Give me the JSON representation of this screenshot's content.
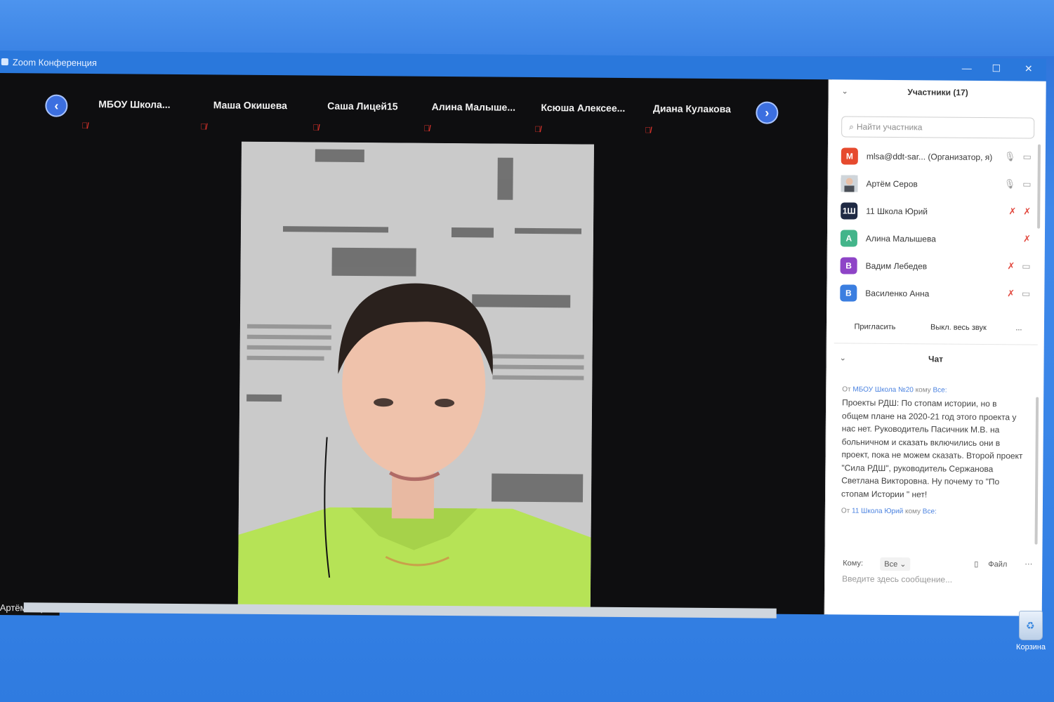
{
  "window": {
    "title": "Zoom Конференция",
    "minimize": "—",
    "maximize": "☐",
    "close": "✕"
  },
  "gallery": {
    "prev": "‹",
    "next": "›",
    "tiles": [
      {
        "name": "МБОУ  Школа...",
        "muted": "🎙̸"
      },
      {
        "name": "Маша Окишева",
        "muted": "🎙̸"
      },
      {
        "name": "Саша Лицей15",
        "muted": "🎙̸"
      },
      {
        "name": "Алина  Малыше...",
        "muted": "🎙̸"
      },
      {
        "name": "Ксюша  Алексее...",
        "muted": "🎙̸"
      },
      {
        "name": "Диана Кулакова",
        "muted": "🎙̸"
      }
    ]
  },
  "speaker": {
    "name": "Артём Серов"
  },
  "participants": {
    "header": "Участники (17)",
    "search_placeholder": "Найти участника",
    "list": [
      {
        "initial": "M",
        "color": "#e64a2e",
        "name": "mlsa@ddt-sar... (Организатор, я)",
        "mic": "🎙",
        "cam": "▭"
      },
      {
        "initial": "",
        "color": "#9aa3ad",
        "name": "Артём Серов",
        "mic": "🎙",
        "cam": "▭"
      },
      {
        "initial": "1Ш",
        "color": "#1f2a44",
        "name": "11 Школа Юрий",
        "mic": "✗",
        "cam": "✗"
      },
      {
        "initial": "А",
        "color": "#43b58a",
        "name": "Алина Малышева",
        "mic": "✗",
        "cam": ""
      },
      {
        "initial": "В",
        "color": "#8e44c7",
        "name": "Вадим Лебедев",
        "mic": "✗",
        "cam": "▭"
      },
      {
        "initial": "В",
        "color": "#3b7ee0",
        "name": "Василенко Анна",
        "mic": "✗",
        "cam": "▭"
      }
    ],
    "invite_label": "Пригласить",
    "mute_all_label": "Выкл. весь звук",
    "more_label": "..."
  },
  "chat": {
    "header": "Чат",
    "msg1_from_prefix": "От",
    "msg1_from": "МБОУ Школа №20",
    "msg1_to_prefix": "кому",
    "msg1_to": "Все:",
    "msg1_text": "Проекты РДШ: По стопам истории, но в общем плане на 2020-21 год этого проекта у нас нет. Руководитель Пасичник М.В. на больничном и сказать включились они в проект, пока не можем сказать. Второй проект \"Сила РДШ\", руководитель Сержанова Светлана Викторовна. Ну почему то \"По стопам Истории \" нет!",
    "msg2_from_prefix": "От",
    "msg2_from": "11 Школа Юрий",
    "msg2_to_prefix": "кому",
    "msg2_to": "Все:",
    "to_label": "Кому:",
    "to_value": "Все",
    "file_label": "Файл",
    "more_label": "···",
    "compose_placeholder": "Введите здесь сообщение..."
  },
  "desktop": {
    "recycle_bin": "Корзина"
  },
  "colors": {
    "accent": "#2a78dc",
    "muted_red": "#e0332b"
  }
}
